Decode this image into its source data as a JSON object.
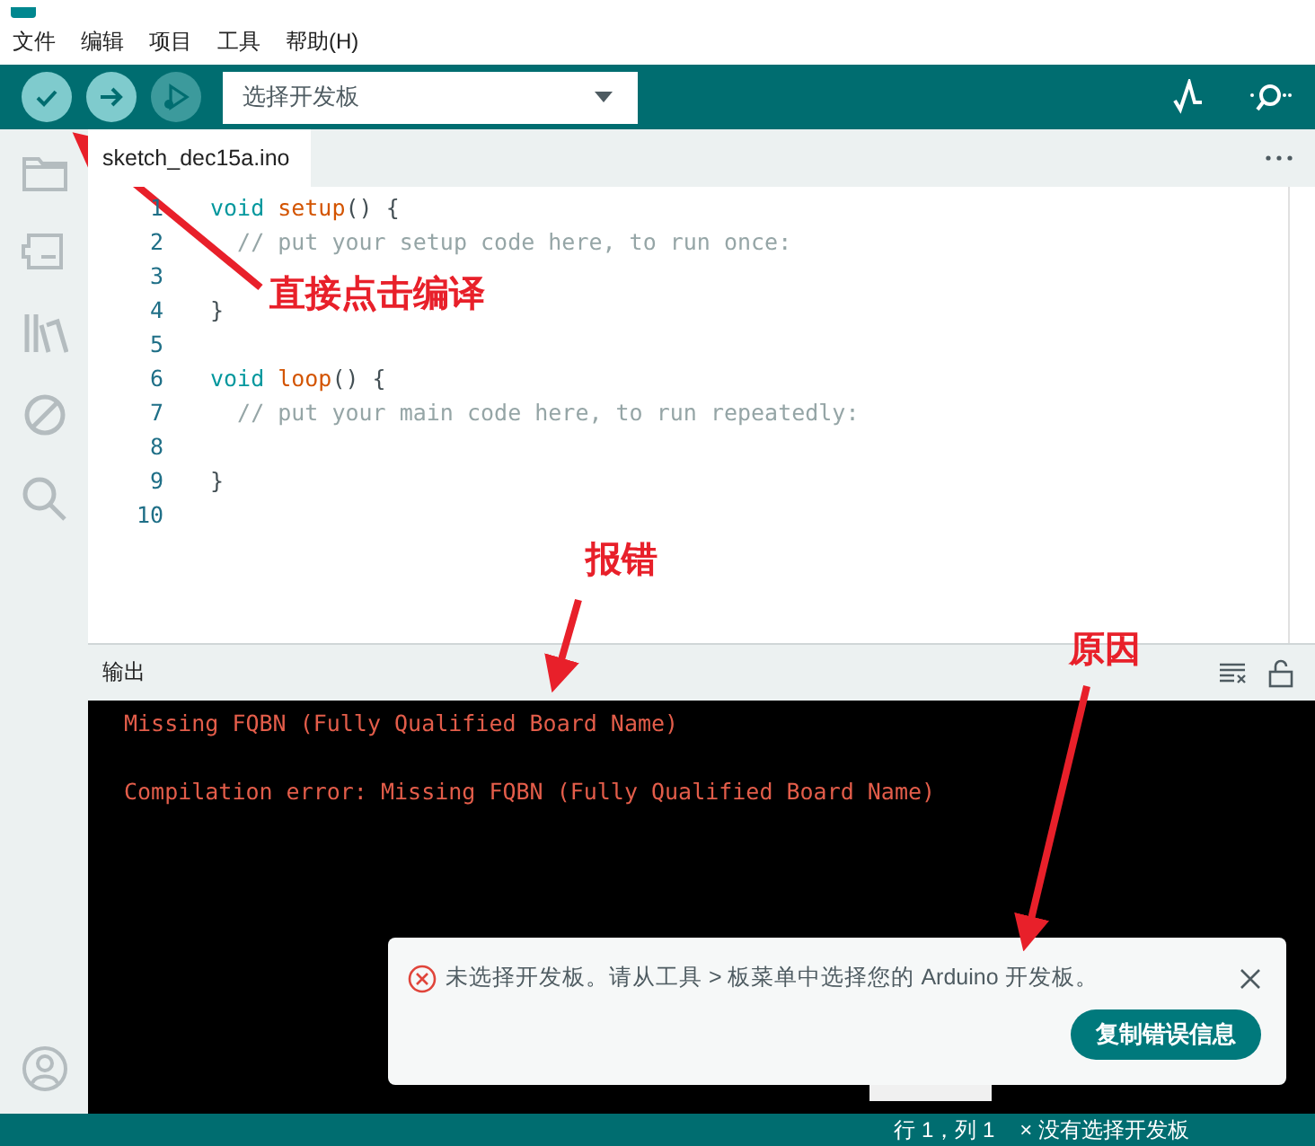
{
  "menu": [
    "文件",
    "编辑",
    "项目",
    "工具",
    "帮助(H)"
  ],
  "toolbar": {
    "buttons": [
      {
        "kind": "verify",
        "disabled": false
      },
      {
        "kind": "upload",
        "disabled": false
      },
      {
        "kind": "debug",
        "disabled": true
      }
    ],
    "board_selector": {
      "value": "选择开发板"
    }
  },
  "tabs": [
    {
      "label": "sketch_dec15a.ino",
      "selected": true
    }
  ],
  "code_lines": [
    {
      "number": "1",
      "segments": [
        {
          "kind": "keyword",
          "text": "void"
        },
        {
          "kind": "function",
          "text": "setup"
        },
        {
          "kind": "plain",
          "text": "() {"
        }
      ]
    },
    {
      "number": "2",
      "segments": [
        {
          "kind": "comment",
          "text": "  // put your setup code here, to run once:"
        }
      ]
    },
    {
      "number": "3"
    },
    {
      "number": "4",
      "segments": [
        {
          "kind": "plain",
          "text": "}"
        }
      ]
    },
    {
      "number": "5"
    },
    {
      "number": "6",
      "segments": [
        {
          "kind": "keyword",
          "text": "void"
        },
        {
          "kind": "function",
          "text": "loop"
        },
        {
          "kind": "plain",
          "text": "() {"
        }
      ]
    },
    {
      "number": "7",
      "segments": [
        {
          "kind": "comment",
          "text": "  // put your main code here, to run repeatedly:"
        }
      ]
    },
    {
      "number": "8"
    },
    {
      "number": "9",
      "segments": [
        {
          "kind": "plain",
          "text": "}"
        }
      ]
    },
    {
      "number": "10"
    }
  ],
  "output": {
    "title": "输出",
    "lines": [
      "Missing FQBN (Fully Qualified Board Name)",
      "Compilation error: Missing FQBN (Fully Qualified Board Name)"
    ]
  },
  "notification": {
    "message": "未选择开发板。请从工具 > 板菜单中选择您的 Arduino 开发板。",
    "button": "复制错误信息"
  },
  "status_bar": {
    "position": "行 1，列 1",
    "board": "× 没有选择开发板"
  },
  "annotations": [
    {
      "text": "直接点击编译"
    },
    {
      "text": "报错"
    },
    {
      "text": "原因"
    }
  ]
}
